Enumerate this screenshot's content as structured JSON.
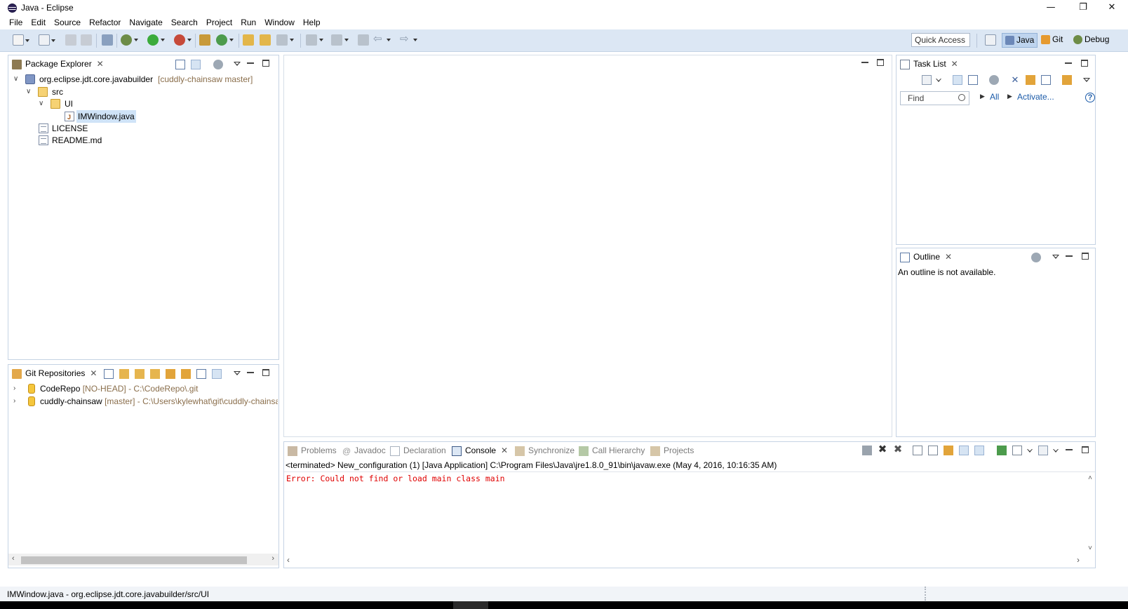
{
  "window": {
    "title": "Java - Eclipse",
    "minimize": "—",
    "restore": "❐",
    "close": "✕"
  },
  "menu": [
    "File",
    "Edit",
    "Source",
    "Refactor",
    "Navigate",
    "Search",
    "Project",
    "Run",
    "Window",
    "Help"
  ],
  "toolbar": {
    "quick_access": "Quick Access",
    "perspectives": [
      {
        "label": "Java",
        "active": true
      },
      {
        "label": "Git",
        "active": false
      },
      {
        "label": "Debug",
        "active": false
      }
    ]
  },
  "package_explorer": {
    "tab": "Package Explorer",
    "tree": [
      {
        "label": "org.eclipse.jdt.core.javabuilder",
        "decoration": "[cuddly-chainsaw master]"
      },
      {
        "label": "src"
      },
      {
        "label": "UI"
      },
      {
        "label": "IMWindow.java",
        "selected": true
      },
      {
        "label": "LICENSE"
      },
      {
        "label": "README.md"
      }
    ]
  },
  "git_repositories": {
    "tab": "Git Repositories",
    "repos": [
      {
        "name": "CodeRepo",
        "branch": "[NO-HEAD]",
        "path": "- C:\\CodeRepo\\.git"
      },
      {
        "name": "cuddly-chainsaw",
        "branch": "[master]",
        "path": "- C:\\Users\\kylewhat\\git\\cuddly-chainsa"
      }
    ]
  },
  "task_list": {
    "tab": "Task List",
    "find_placeholder": "Find",
    "all": "All",
    "activate": "Activate...",
    "help": "?"
  },
  "outline": {
    "tab": "Outline",
    "message": "An outline is not available."
  },
  "bottom_tabs": {
    "problems": "Problems",
    "javadoc": "Javadoc",
    "declaration": "Declaration",
    "console": "Console",
    "synchronize": "Synchronize",
    "call_hierarchy": "Call Hierarchy",
    "projects": "Projects"
  },
  "console": {
    "header": "<terminated> New_configuration (1) [Java Application] C:\\Program Files\\Java\\jre1.8.0_91\\bin\\javaw.exe (May 4, 2016, 10:16:35 AM)",
    "error": "Error: Could not find or load main class main"
  },
  "statusbar": {
    "text": "IMWindow.java - org.eclipse.jdt.core.javabuilder/src/UI"
  },
  "colors": {
    "toolbar_bg": "#dce7f4",
    "error_text": "#e00000",
    "selection": "#cfe3f7"
  }
}
